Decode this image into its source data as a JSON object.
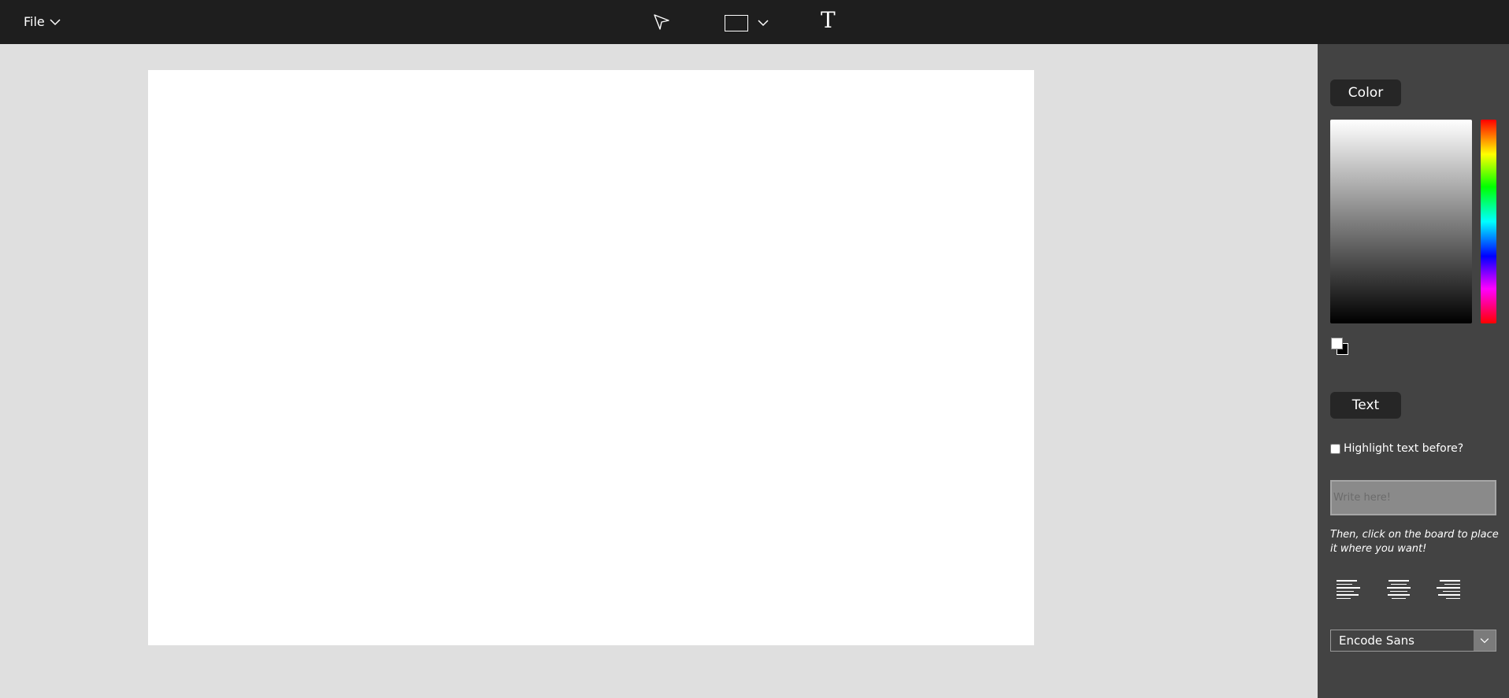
{
  "topbar": {
    "file_label": "File",
    "tools": {
      "select_icon": "cursor-arrow-icon",
      "shape_icon": "rectangle-icon",
      "text_glyph": "T"
    }
  },
  "panel": {
    "color_section_label": "Color",
    "colors": {
      "foreground": "#ffffff",
      "background": "#000000"
    },
    "text_section_label": "Text",
    "highlight_label": "Highlight text before?",
    "highlight_checked": false,
    "text_input": {
      "placeholder": "Write here!",
      "value": ""
    },
    "hint": "Then, click on the board to place it where you want!",
    "alignments": [
      "left",
      "center",
      "right"
    ],
    "font": {
      "selected": "Encode Sans"
    }
  }
}
